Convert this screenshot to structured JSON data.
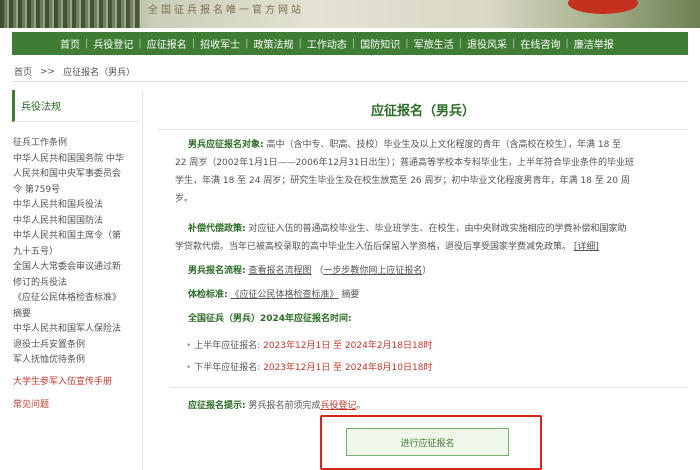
{
  "banner": {
    "tagline": "全国征兵报名唯一官方网站"
  },
  "nav": [
    "首页",
    "兵役登记",
    "应征报名",
    "招收军士",
    "政策法规",
    "工作动态",
    "国防知识",
    "军旅生活",
    "退役风采",
    "在线咨询",
    "廉洁举报"
  ],
  "breadcrumb": {
    "home": "首页",
    "sep": ">>",
    "current": "应征报名（男兵）"
  },
  "sidebar": {
    "heading": "兵役法规",
    "items": [
      "征兵工作条例",
      "中华人民共和国国务院 中华",
      "人民共和国中央军事委员会",
      "令 第759号",
      "中华人民共和国兵役法",
      "中华人民共和国国防法",
      "中华人民共和国主席令（第",
      "九十五号）",
      "全国人大常委会审议通过新",
      "修订的兵役法",
      "《应征公民体格检查标准》",
      "摘要",
      "中华人民共和国军人保险法",
      "退役士兵安置条例",
      "军人抚恤优待条例"
    ],
    "highlight": "大学生参军入伍宣传手册",
    "sub": "常见问题"
  },
  "main": {
    "title": "应征报名（男兵）",
    "target_label": "男兵应征报名对象:",
    "target_text_1": "高中（含中专、职高、技校）毕业生及以上文化程度的青年（含高校在校生），年满 18 至",
    "target_text_2": "22 周岁（2002年1月1日——2006年12月31日出生）；普通高等学校本专科毕业生，上半年符合毕业条件的毕业班",
    "target_text_3": "学生，年满 18 至 24 周岁；研究生毕业生及在校生放宽至 26 周岁；初中毕业文化程度男青年，年满 18 至 20 周",
    "target_text_4": "岁。",
    "comp_label": "补偿代偿政策:",
    "comp_text_1": "对应征入伍的普通高校毕业生、毕业班学生、在校生，由中央财政实施相应的学费补偿和国家助",
    "comp_text_2": "学贷款代偿。当年已被高校录取的高中毕业生入伍后保留入学资格，退役后享受国家学费减免政策。",
    "comp_link": "[详细]",
    "process_label": "男兵报名流程:",
    "process_link": "查看报名流程图",
    "process_link2": "一步步教你网上应征报名",
    "paren_open": "（",
    "paren_close": "）",
    "exam_label": "体检标准:",
    "exam_link": "《应征公民体格检查标准》",
    "exam_suffix": "摘要",
    "time_label": "全国征兵（男兵）2024年应征报名时间:",
    "first_label": "上半年应征报名:",
    "first_time": "2023年12月1日 至 2024年2月18日18时",
    "second_label": "下半年应征报名:",
    "second_time": "2023年12月1日 至 2024年8月10日18时",
    "hint_label": "应征报名提示:",
    "hint_text": "男兵报名前须完成",
    "hint_link": "兵役登记",
    "hint_end": "。",
    "apply_button": "进行应征报名"
  }
}
